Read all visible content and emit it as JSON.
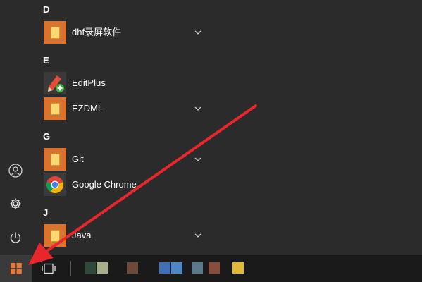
{
  "start_menu": {
    "groups": [
      {
        "letter": "D",
        "apps": [
          {
            "label": "dhf录屏软件",
            "icon": "folder-icon",
            "expandable": true
          }
        ]
      },
      {
        "letter": "E",
        "apps": [
          {
            "label": "EditPlus",
            "icon": "editplus-icon",
            "expandable": false
          },
          {
            "label": "EZDML",
            "icon": "folder-icon",
            "expandable": true
          }
        ]
      },
      {
        "letter": "G",
        "apps": [
          {
            "label": "Git",
            "icon": "folder-icon",
            "expandable": true
          },
          {
            "label": "Google Chrome",
            "icon": "chrome-icon",
            "expandable": false
          }
        ]
      },
      {
        "letter": "J",
        "apps": [
          {
            "label": "Java",
            "icon": "folder-icon",
            "expandable": true
          }
        ]
      }
    ],
    "rail": {
      "user_icon": "user-icon",
      "settings_icon": "gear-icon",
      "power_icon": "power-icon"
    }
  },
  "taskbar": {
    "start_icon": "windows-logo-icon",
    "taskview_icon": "task-view-icon"
  },
  "annotation": {
    "arrow_color": "#e8262b"
  },
  "colors": {
    "menu_bg": "#2b2b2b",
    "tile_accent": "#d9732f",
    "taskbar_bg": "#1a1a1a",
    "folder_yellow": "#f8d775"
  }
}
